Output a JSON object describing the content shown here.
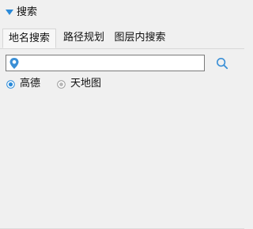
{
  "panel": {
    "title": "搜索",
    "collapse_icon": "triangle-down-icon",
    "accent_color": "#2b8ad8"
  },
  "tabs": [
    {
      "label": "地名搜索",
      "active": true
    },
    {
      "label": "路径规划",
      "active": false
    },
    {
      "label": "图层内搜索",
      "active": false
    }
  ],
  "search": {
    "value": "",
    "placeholder": "",
    "pin_icon": "location-pin-icon",
    "button_icon": "magnifier-icon"
  },
  "providers": {
    "options": [
      {
        "label": "高德",
        "selected": true
      },
      {
        "label": "天地图",
        "selected": false
      }
    ]
  }
}
